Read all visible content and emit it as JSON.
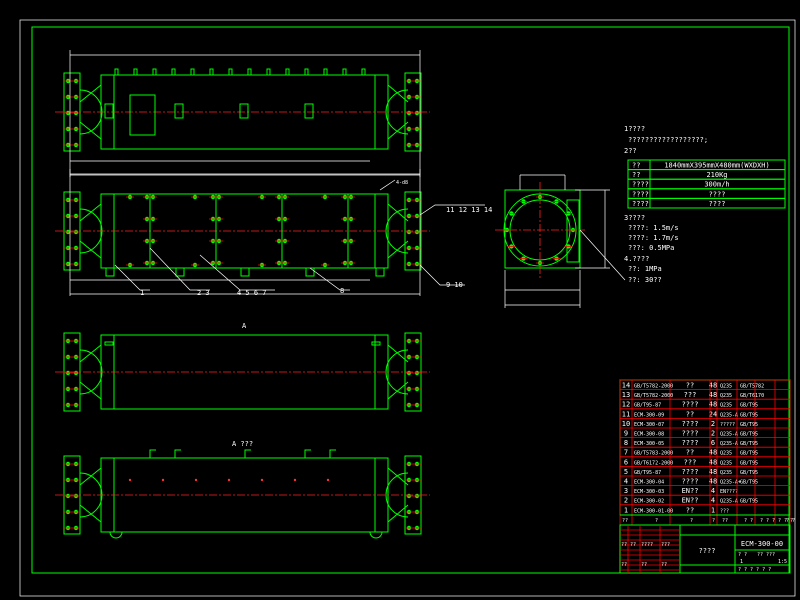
{
  "notes": {
    "h1": "1????",
    "l1": "??????????????????;",
    "h2": "2??",
    "spec_table": [
      [
        "??",
        "1840mmX395mmX480mm(WXDXH)"
      ],
      [
        "??",
        "210Kg"
      ],
      [
        "????",
        "300m/h"
      ],
      [
        "????",
        "????"
      ],
      [
        "????",
        "????"
      ]
    ],
    "h3": "3????",
    "l3a": "????: 1.5m/s",
    "l3b": "????: 1.7m/s",
    "l3c": "???: 0.5MPa",
    "h4": "4.????",
    "l4a": "??: 1MPa",
    "l4b": "??: 30??"
  },
  "callouts": [
    "1",
    "2  3",
    "4  5  6  7",
    "8",
    "11 12 13 14",
    "9  10",
    "A",
    "A ???",
    "4-d8"
  ],
  "parts": [
    [
      "14",
      "GB/T5782-2000",
      "??",
      "48",
      "Q235",
      "GB/T5782"
    ],
    [
      "13",
      "GB/T5782-2000",
      "???",
      "48",
      "Q235",
      "GB/T6170"
    ],
    [
      "12",
      "GB/T95-87",
      "????",
      "48",
      "Q235",
      "GB/T95"
    ],
    [
      "11",
      "ECM-300-09",
      "??",
      "24",
      "Q235-A",
      "GB/T95"
    ],
    [
      "10",
      "ECM-300-07",
      "????",
      "2",
      "?????",
      "GB/T95"
    ],
    [
      "9",
      "ECM-300-08",
      "????",
      "2",
      "Q235-A",
      "GB/T95"
    ],
    [
      "8",
      "ECM-300-05",
      "????",
      "6",
      "Q235-A",
      "GB/T95"
    ],
    [
      "7",
      "GB/T5783-2000",
      "??",
      "48",
      "Q235",
      "GB/T95"
    ],
    [
      "6",
      "GB/T6172-2000",
      "???",
      "48",
      "Q235",
      "GB/T95"
    ],
    [
      "5",
      "GB/T95-87",
      "????",
      "48",
      "Q235",
      "GB/T95"
    ],
    [
      "4",
      "ECM-300-04",
      "????",
      "48",
      "Q235-A+",
      "GB/T95"
    ],
    [
      "3",
      "ECM-300-03",
      "EN??",
      "4",
      "EN????",
      ""
    ],
    [
      "2",
      "ECM-300-02",
      "EN??",
      "4",
      "Q235-A",
      "GB/T95"
    ],
    [
      "1",
      "ECM-300-01-00",
      "??",
      "1",
      "???",
      ""
    ]
  ],
  "parts_header": [
    "??",
    "?",
    "?",
    "?",
    "??",
    "? ?",
    "? ? ?",
    "? ? ?",
    "? ?"
  ],
  "title_block": {
    "name": "????",
    "drawing_no": "ECM-300-00",
    "scale_label": "? ?",
    "weight_label": "?? ???",
    "qty": "1",
    "scale": "1:5",
    "sheet": "? ? ? ? ? ?",
    "rev_labels": [
      "?? ??",
      "????",
      "???",
      "??",
      "??",
      "??"
    ]
  }
}
